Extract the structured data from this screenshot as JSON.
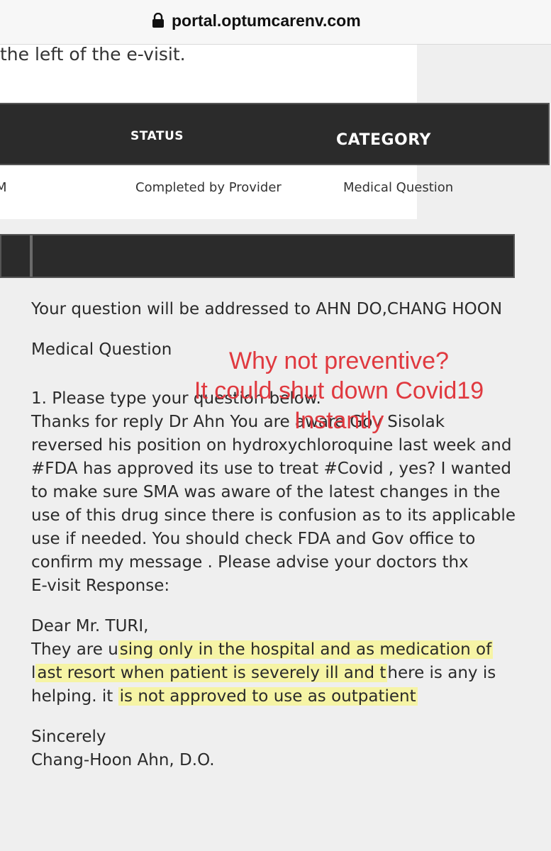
{
  "browser": {
    "url": "portal.optumcarenv.com"
  },
  "intro_text": "the left of the e-visit.",
  "table": {
    "headers": {
      "status": "STATUS",
      "category": "CATEGORY"
    },
    "row": {
      "time_fragment": "M",
      "status": "Completed by Provider",
      "category": "Medical Question"
    }
  },
  "message": {
    "addressed": "Your question will be addressed to AHN DO,CHANG HOON",
    "category": "Medical Question",
    "question_label": "1. Please type your question below.",
    "question_body": "Thanks for reply Dr Ahn You are aware Gov Sisolak reversed his position on hydroxychloroquine last week and #FDA has approved its use to treat #Covid , yes? I wanted to make sure SMA was aware of the latest changes in the use of this drug since there is confusion as to its applicable use if needed. You should check FDA and Gov office to confirm my message . Please advise your doctors thx",
    "response_label": "E-visit Response:",
    "greeting": "Dear Mr. TURI,",
    "response": {
      "part1": "They are u",
      "hl1": "sing only in the hospital and as medication of",
      "part2": " l",
      "hl2": "ast resort when patient is severely ill and t",
      "part3": "here is any is helping. it ",
      "hl3": "is not approved to use as outpatient"
    },
    "closing": "Sincerely",
    "signature": "Chang-Hoon Ahn, D.O."
  },
  "annotation": {
    "line1": "Why not preventive?",
    "line2": "It could shut down Covid19",
    "line3": "Instantly",
    "color": "#e0393f"
  },
  "colors": {
    "header_bg": "#2b2b2b",
    "highlight": "#f8f68c"
  }
}
